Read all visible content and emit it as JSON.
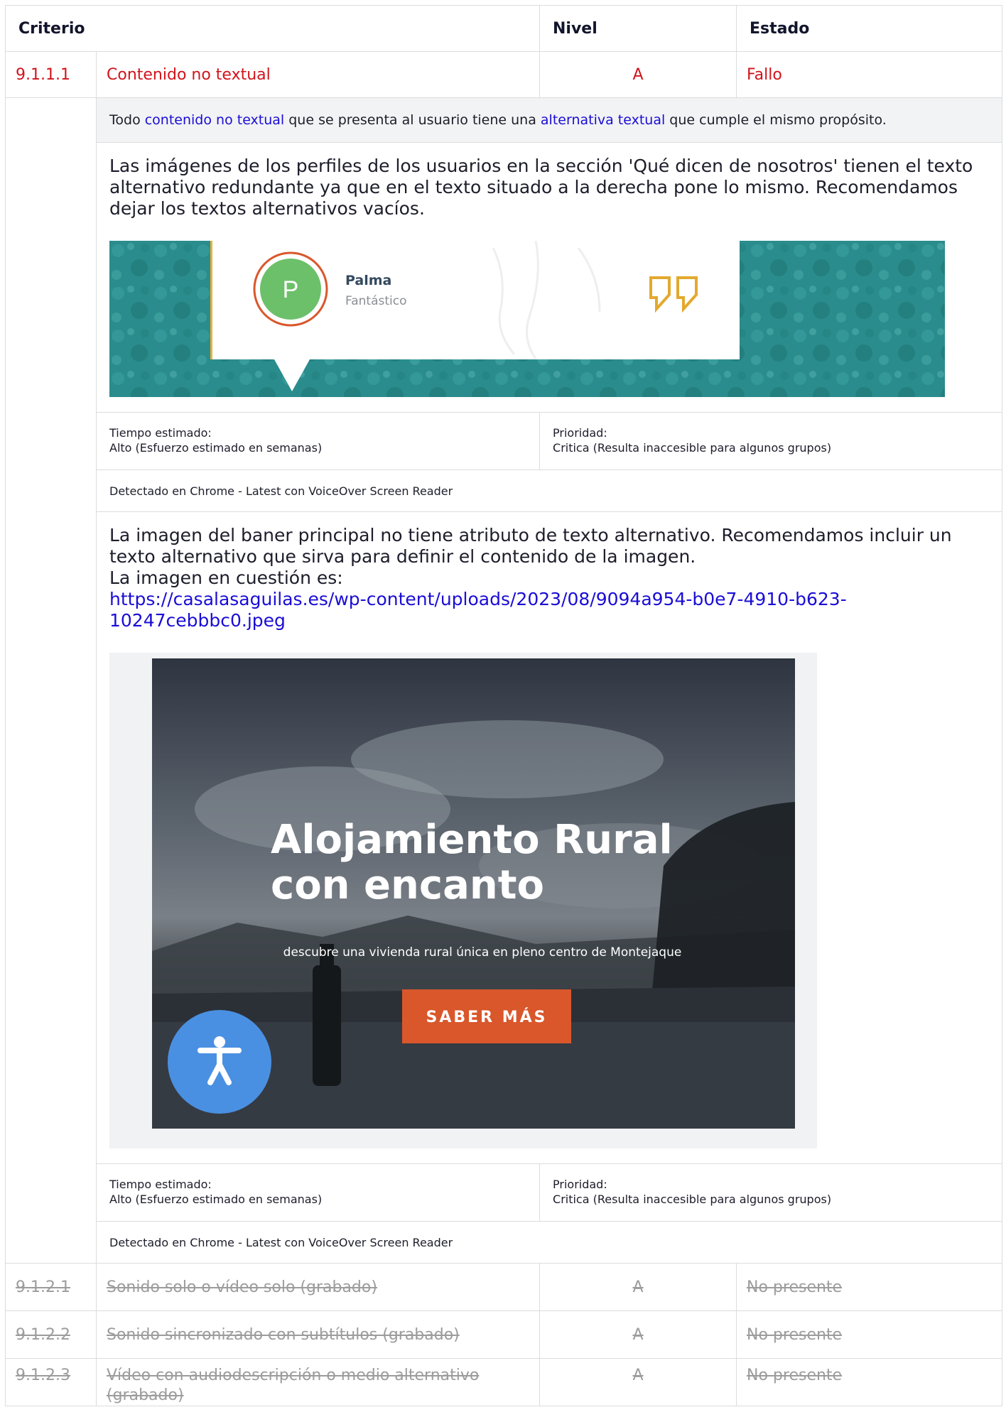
{
  "header": {
    "criterio": "Criterio",
    "nivel": "Nivel",
    "estado": "Estado"
  },
  "failing_criterion": {
    "id": "9.1.1.1",
    "name": "Contenido no textual",
    "level": "A",
    "status": "Fallo",
    "description": {
      "prefix": "Todo ",
      "link1": "contenido no textual",
      "middle": " que se presenta al usuario tiene una ",
      "link2": "alternativa textual",
      "suffix": " que cumple el mismo propósito."
    }
  },
  "findings": [
    {
      "text": "Las imágenes de los perfiles de los usuarios en la sección 'Qué dicen de nosotros' tienen el texto alternativo redundante ya que en el texto situado a la derecha pone lo mismo. Recomendamos dejar los textos alternativos vacíos.",
      "screenshot": {
        "avatar_letter": "P",
        "name": "Palma",
        "review": "Fantástico",
        "quote_glyph": "”"
      },
      "time_label": "Tiempo estimado:",
      "time_value": "Alto (Esfuerzo estimado en semanas)",
      "priority_label": "Prioridad:",
      "priority_value": "Critica (Resulta inaccesible para algunos grupos)",
      "detected": "Detectado en Chrome - Latest con VoiceOver Screen Reader"
    },
    {
      "text_line1": "La imagen del baner principal no tiene atributo de texto alternativo. Recomendamos incluir un texto alternativo que sirva para definir el contenido de la imagen.",
      "text_line2": "La imagen en cuestión es:",
      "url": "https://casalasaguilas.es/wp-content/uploads/2023/08/9094a954-b0e7-4910-b623-10247cebbbc0.jpeg",
      "screenshot": {
        "headline_1": "Alojamiento Rural",
        "headline_2": "con encanto",
        "subtitle": "descubre una vivienda rural única en pleno centro de Montejaque",
        "button": "SABER MÁS",
        "accessibility_icon": "accessibility-icon"
      },
      "time_label": "Tiempo estimado:",
      "time_value": "Alto (Esfuerzo estimado en semanas)",
      "priority_label": "Prioridad:",
      "priority_value": "Critica (Resulta inaccesible para algunos grupos)",
      "detected": "Detectado en Chrome - Latest con VoiceOver Screen Reader"
    }
  ],
  "not_present": [
    {
      "id": "9.1.2.1",
      "name": "Sonido solo o vídeo solo (grabado)",
      "level": "A",
      "status": "No presente"
    },
    {
      "id": "9.1.2.2",
      "name": "Sonido sincronizado con subtítulos (grabado)",
      "level": "A",
      "status": "No presente"
    },
    {
      "id": "9.1.2.3",
      "name": "Vídeo con audiodescripción o medio alternativo (grabado)",
      "level": "A",
      "status": "No presente"
    }
  ],
  "colors": {
    "fail": "#d1141c",
    "link": "#1a0dd6",
    "muted": "#9c9c9c",
    "teal": "#2a8c8c",
    "orange": "#d9572b",
    "avatar_green": "#6cc06a",
    "a11y_blue": "#4a90e2"
  }
}
